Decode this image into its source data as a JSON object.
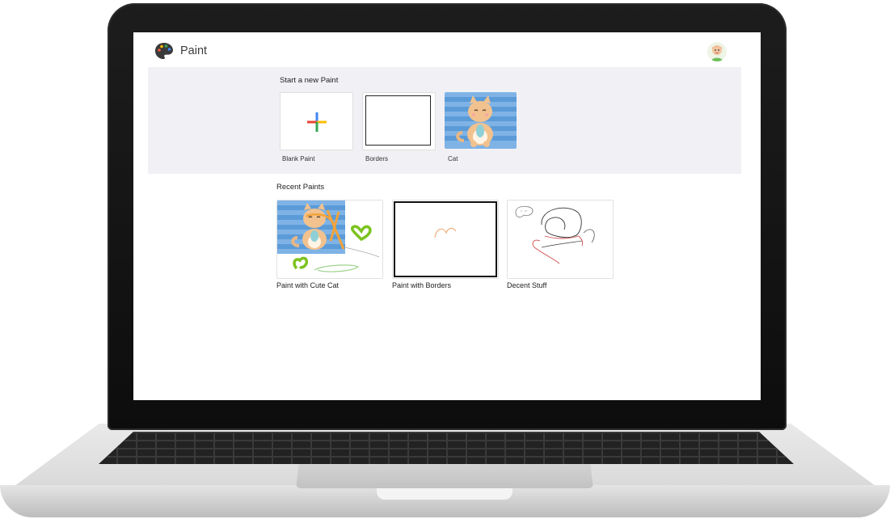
{
  "app": {
    "title": "Paint",
    "logo_icon": "palette-icon",
    "avatar_icon": "user-avatar-icon"
  },
  "templates": {
    "heading": "Start a new Paint",
    "items": [
      {
        "label": "Blank Paint",
        "icon": "plus-icon"
      },
      {
        "label": "Borders",
        "icon": "bordered-canvas-icon"
      },
      {
        "label": "Cat",
        "icon": "cat-image-icon"
      }
    ]
  },
  "recent": {
    "heading": "Recent Paints",
    "items": [
      {
        "label": "Paint with Cute Cat",
        "thumbnail": "cat-drawing-thumbnail"
      },
      {
        "label": "Paint with Borders",
        "thumbnail": "border-drawing-thumbnail"
      },
      {
        "label": "Decent Stuff",
        "thumbnail": "scribble-thumbnail"
      }
    ]
  },
  "colors": {
    "section_background": "#f1f1f5",
    "plus_blue": "#4285f4",
    "plus_red": "#ea4335",
    "plus_yellow": "#fbbc05",
    "plus_green": "#34a853",
    "cat_stripe_light": "#7fb3e6",
    "cat_stripe_dark": "#5b9bd8"
  }
}
